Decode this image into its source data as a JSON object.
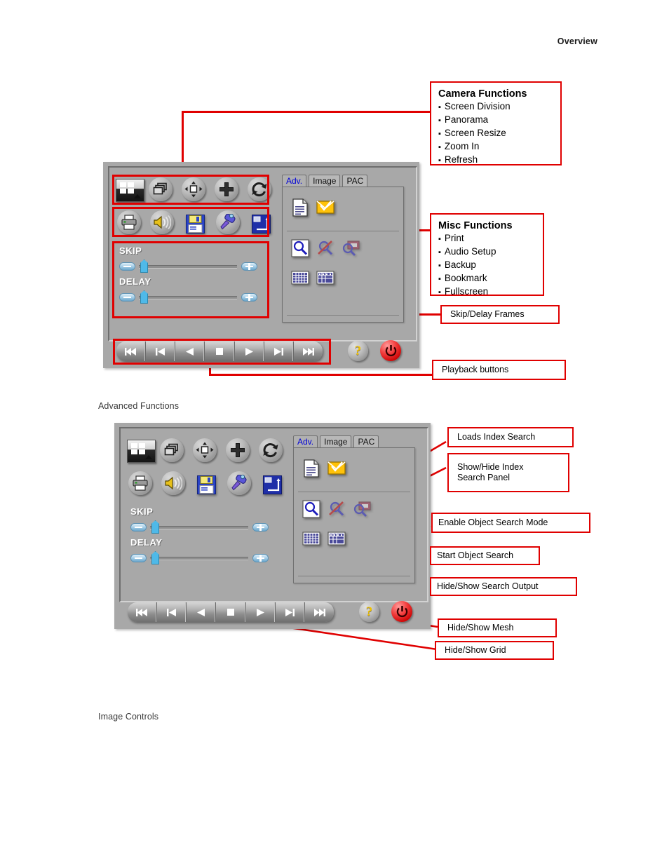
{
  "page": {
    "header": "Overview",
    "captions": {
      "advanced_functions": "Advanced Functions",
      "image_controls": "Image Controls"
    }
  },
  "colors": {
    "annotation_red": "#e00000",
    "panel_gray": "#a8a8a8",
    "active_tab_text": "#0000d8",
    "power_red": "#e01010",
    "help_yellow": "#f2c200",
    "slider_blue": "#4fb9e8"
  },
  "figure1": {
    "name": "Playback control panel overview",
    "panel": {
      "tabs": [
        {
          "label": "Adv.",
          "active": true
        },
        {
          "label": "Image",
          "active": false
        },
        {
          "label": "PAC",
          "active": false
        }
      ],
      "camera_toolbar": [
        {
          "icon": "screen-division-icon",
          "title": "Screen Division"
        },
        {
          "icon": "panorama-icon",
          "title": "Panorama"
        },
        {
          "icon": "screen-resize-icon",
          "title": "Screen Resize"
        },
        {
          "icon": "zoom-in-icon",
          "title": "Zoom In"
        },
        {
          "icon": "refresh-icon",
          "title": "Refresh"
        }
      ],
      "misc_toolbar": [
        {
          "icon": "print-icon",
          "title": "Print"
        },
        {
          "icon": "audio-setup-icon",
          "title": "Audio Setup"
        },
        {
          "icon": "backup-icon",
          "title": "Backup"
        },
        {
          "icon": "bookmark-icon",
          "title": "Bookmark"
        },
        {
          "icon": "fullscreen-icon",
          "title": "Fullscreen"
        }
      ],
      "sliders": [
        {
          "label": "SKIP",
          "minus": "minus-button",
          "plus": "plus-button",
          "value": 12
        },
        {
          "label": "DELAY",
          "minus": "minus-button",
          "plus": "plus-button",
          "value": 12
        }
      ],
      "playback_buttons": [
        {
          "icon": "skip-to-start-icon"
        },
        {
          "icon": "previous-frame-icon"
        },
        {
          "icon": "play-reverse-icon"
        },
        {
          "icon": "stop-icon"
        },
        {
          "icon": "play-icon"
        },
        {
          "icon": "next-frame-icon"
        },
        {
          "icon": "skip-to-end-icon"
        }
      ],
      "help_button": {
        "icon": "question-mark-icon",
        "label": "?"
      },
      "power_button": {
        "icon": "power-icon"
      },
      "adv_tab_icons": [
        {
          "icon": "loads-index-search-icon",
          "row": 1
        },
        {
          "icon": "bookmark-check-icon",
          "row": 1
        },
        {
          "icon": "object-search-icon",
          "row": 2
        },
        {
          "icon": "disable-object-search-icon",
          "row": 2
        },
        {
          "icon": "search-output-icon",
          "row": 2
        },
        {
          "icon": "mesh-icon",
          "row": 3
        },
        {
          "icon": "grid-icon",
          "row": 3
        }
      ]
    },
    "annotations": [
      {
        "name": "camera-functions-callout",
        "title": "Camera Functions",
        "items": [
          "Screen Division",
          "Panorama",
          "Screen Resize",
          "Zoom In",
          "Refresh"
        ]
      },
      {
        "name": "misc-functions-callout",
        "title": "Misc Functions",
        "items": [
          "Print",
          "Audio Setup",
          "Backup",
          "Bookmark",
          "Fullscreen"
        ]
      },
      {
        "name": "skip-delay-frames-callout",
        "text": "Skip/Delay Frames"
      },
      {
        "name": "playback-buttons-callout",
        "text": "Playback buttons"
      }
    ]
  },
  "figure2": {
    "name": "Advanced functions panel",
    "panel": {
      "tabs": [
        {
          "label": "Adv.",
          "active": true
        },
        {
          "label": "Image",
          "active": false
        },
        {
          "label": "PAC",
          "active": false
        }
      ],
      "sliders": [
        {
          "label": "SKIP"
        },
        {
          "label": "DELAY"
        }
      ]
    },
    "annotations": [
      {
        "name": "loads-index-search-callout",
        "text": "Loads Index Search"
      },
      {
        "name": "show-hide-index-search-panel-callout",
        "text": "Show/Hide Index\nSearch Panel"
      },
      {
        "name": "enable-object-search-mode-callout",
        "text": "Enable Object Search Mode"
      },
      {
        "name": "start-object-search-callout",
        "text": "Start Object Search"
      },
      {
        "name": "hide-show-search-output-callout",
        "text": "Hide/Show Search Output"
      },
      {
        "name": "hide-show-mesh-callout",
        "text": "Hide/Show Mesh"
      },
      {
        "name": "hide-show-grid-callout",
        "text": "Hide/Show Grid"
      }
    ]
  }
}
